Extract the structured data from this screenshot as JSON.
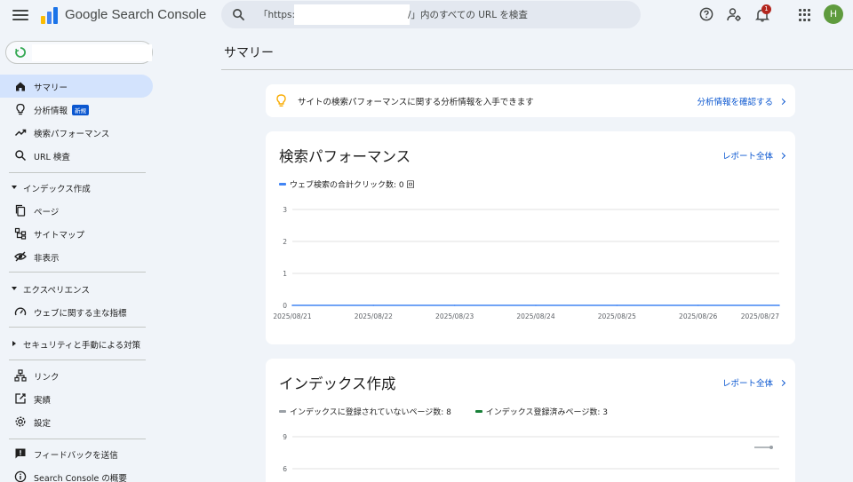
{
  "app": {
    "title": "Google Search Console"
  },
  "search": {
    "placeholder_prefix": "「https://",
    "placeholder_suffix": "/」内のすべての URL を検査"
  },
  "header": {
    "notification_count": "1",
    "avatar_letter": "H"
  },
  "sidebar": {
    "items": [
      {
        "label": "サマリー",
        "icon": "home-icon",
        "active": true
      },
      {
        "label": "分析情報",
        "icon": "lightbulb-icon",
        "badge": "新規"
      },
      {
        "label": "検索パフォーマンス",
        "icon": "trending-up-icon"
      },
      {
        "label": "URL 検査",
        "icon": "search-icon"
      }
    ],
    "sections": [
      {
        "label": "インデックス作成",
        "expanded": true,
        "items": [
          {
            "label": "ページ",
            "icon": "pages-icon"
          },
          {
            "label": "サイトマップ",
            "icon": "sitemap-icon"
          },
          {
            "label": "非表示",
            "icon": "visibility-off-icon"
          }
        ]
      },
      {
        "label": "エクスペリエンス",
        "expanded": true,
        "items": [
          {
            "label": "ウェブに関する主な指標",
            "icon": "speed-icon"
          }
        ]
      },
      {
        "label": "セキュリティと手動による対策",
        "expanded": false,
        "items": []
      }
    ],
    "bottom_items": [
      {
        "label": "リンク",
        "icon": "links-icon"
      },
      {
        "label": "実績",
        "icon": "achievements-icon"
      },
      {
        "label": "設定",
        "icon": "settings-icon"
      }
    ],
    "footer_items": [
      {
        "label": "フィードバックを送信",
        "icon": "feedback-icon"
      },
      {
        "label": "Search Console の概要",
        "icon": "info-icon"
      }
    ]
  },
  "main": {
    "page_title": "サマリー",
    "insight_banner": {
      "text": "サイトの検索パフォーマンスに関する分析情報を入手できます",
      "link": "分析情報を確認する"
    },
    "performance_card": {
      "title": "検索パフォーマンス",
      "link": "レポート全体"
    },
    "indexing_card": {
      "title": "インデックス作成",
      "link": "レポート全体"
    }
  },
  "colors": {
    "accent": "#0b57d0",
    "clicks_line": "#4285f4",
    "not_indexed": "#9aa0a6",
    "indexed": "#188038",
    "active_nav": "#d3e3fd",
    "background": "#f0f4f9"
  },
  "chart_data": [
    {
      "type": "line",
      "x": [
        "2025/08/21",
        "2025/08/22",
        "2025/08/23",
        "2025/08/24",
        "2025/08/25",
        "2025/08/26",
        "2025/08/27"
      ],
      "y_ticks": [
        0,
        1,
        2,
        3
      ],
      "ylim": [
        0,
        3
      ],
      "grid": true,
      "series": [
        {
          "name": "ウェブ検索の合計クリック数: 0 回",
          "color": "#4285f4",
          "values": [
            0,
            0,
            0,
            0,
            0,
            0,
            0
          ]
        }
      ]
    },
    {
      "type": "line",
      "y_ticks": [
        6,
        9
      ],
      "grid": true,
      "series": [
        {
          "name": "インデックスに登録されていないページ数: 8",
          "color": "#9aa0a6",
          "values": [
            8
          ]
        },
        {
          "name": "インデックス登録済みページ数: 3",
          "color": "#188038",
          "values": [
            3
          ]
        }
      ]
    }
  ]
}
